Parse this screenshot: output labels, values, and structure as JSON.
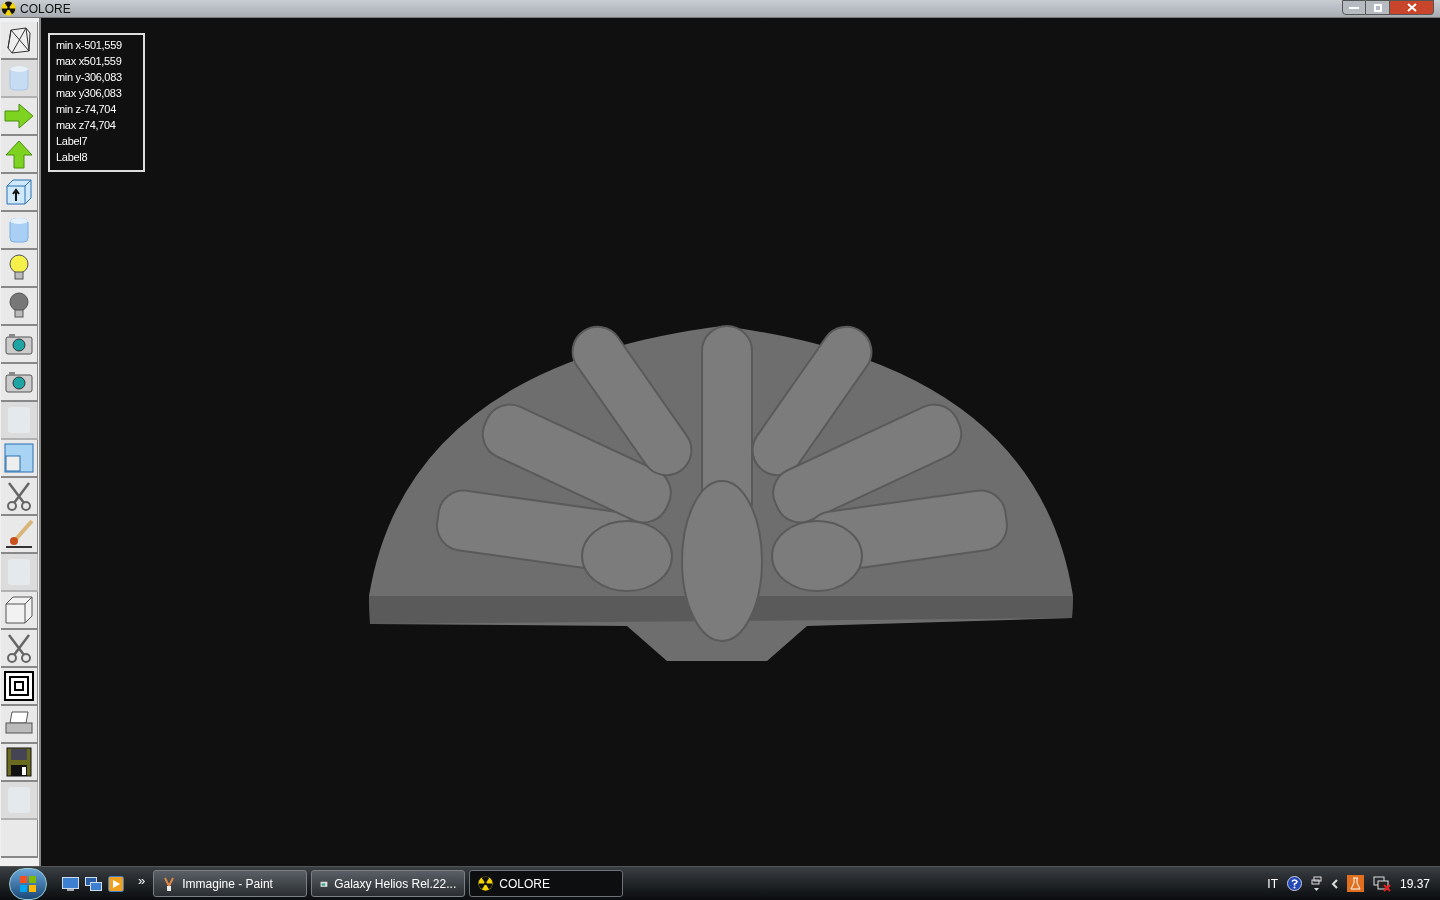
{
  "window": {
    "title": "COLORE"
  },
  "toolbar": [
    {
      "kind": "wireframe",
      "disabled": false
    },
    {
      "kind": "cylinder",
      "disabled": true
    },
    {
      "kind": "arrow-right",
      "disabled": false
    },
    {
      "kind": "arrow-up",
      "disabled": false
    },
    {
      "kind": "cube-arrow",
      "disabled": false
    },
    {
      "kind": "cylinder",
      "disabled": false
    },
    {
      "kind": "bulb-on",
      "disabled": false
    },
    {
      "kind": "bulb-off",
      "disabled": false
    },
    {
      "kind": "camera",
      "disabled": false
    },
    {
      "kind": "camera",
      "disabled": false
    },
    {
      "kind": "blank",
      "disabled": true
    },
    {
      "kind": "windows",
      "disabled": false
    },
    {
      "kind": "scissors",
      "disabled": false
    },
    {
      "kind": "brush",
      "disabled": false
    },
    {
      "kind": "blank",
      "disabled": true
    },
    {
      "kind": "cube",
      "disabled": false
    },
    {
      "kind": "scissors",
      "disabled": false
    },
    {
      "kind": "squares",
      "disabled": false
    },
    {
      "kind": "printer",
      "disabled": false
    },
    {
      "kind": "floppy",
      "disabled": false
    },
    {
      "kind": "blank",
      "disabled": true
    },
    {
      "kind": "empty",
      "disabled": false
    }
  ],
  "info_labels": [
    "min x-501,559",
    "max x501,559",
    "min y-306,083",
    "max y306,083",
    "min z-74,704",
    "max z74,704",
    "Label7",
    "Label8"
  ],
  "taskbar": {
    "chevron": "»",
    "tasks": [
      {
        "kind": "paint",
        "label": "Immagine - Paint",
        "selected": false
      },
      {
        "kind": "folder",
        "label": "Galaxy Helios  Rel.22...",
        "selected": false
      },
      {
        "kind": "radiation",
        "label": "COLORE",
        "selected": true
      }
    ],
    "language": "IT",
    "clock": "19.37"
  }
}
